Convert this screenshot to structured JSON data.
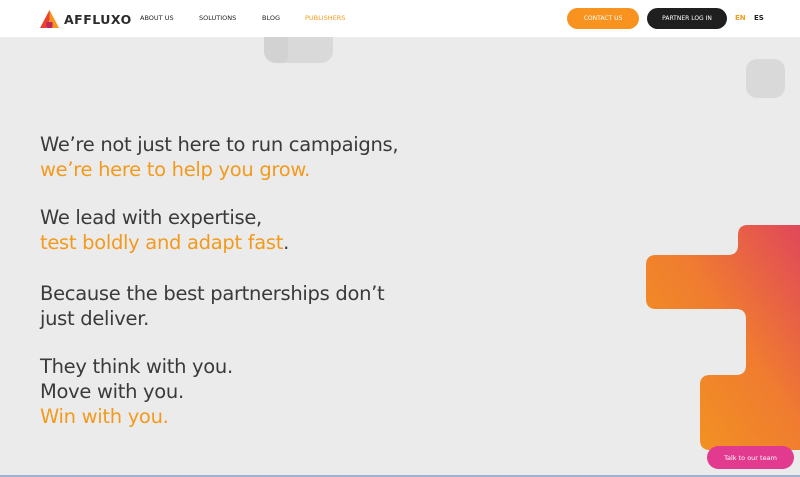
{
  "header": {
    "logo_text": "AFFLUXO",
    "nav": [
      {
        "label": "ABOUT US"
      },
      {
        "label": "SOLUTIONS"
      },
      {
        "label": "BLOG"
      },
      {
        "label": "PUBLISHERS",
        "active": true
      }
    ],
    "contact_label": "CONTACT US",
    "partner_label": "PARTNER LOG IN",
    "languages": [
      "EN",
      "ES"
    ],
    "active_language": "EN"
  },
  "hero": {
    "block1": [
      "We’re not just here to run campaigns,",
      "we’re here to help you grow."
    ],
    "block2": [
      "We lead with expertise,",
      "test boldly and adapt fast",
      "."
    ],
    "block3": [
      "Because the best partnerships don’t",
      "just deliver."
    ],
    "block4": [
      "They think with you.",
      "Move with you.",
      "Win with you."
    ]
  },
  "chat": {
    "label": "Talk to our team"
  },
  "colors": {
    "accent": "#f39a1c",
    "contact_button": "#f7931e",
    "partner_button": "#1f1f1f",
    "chat_button": "#e13a8f",
    "text": "#3a3a3a",
    "background": "#ebebeb"
  },
  "icons": {
    "logo": "affluxo-logo-icon",
    "decorative_shape": "gradient-block-shape"
  }
}
